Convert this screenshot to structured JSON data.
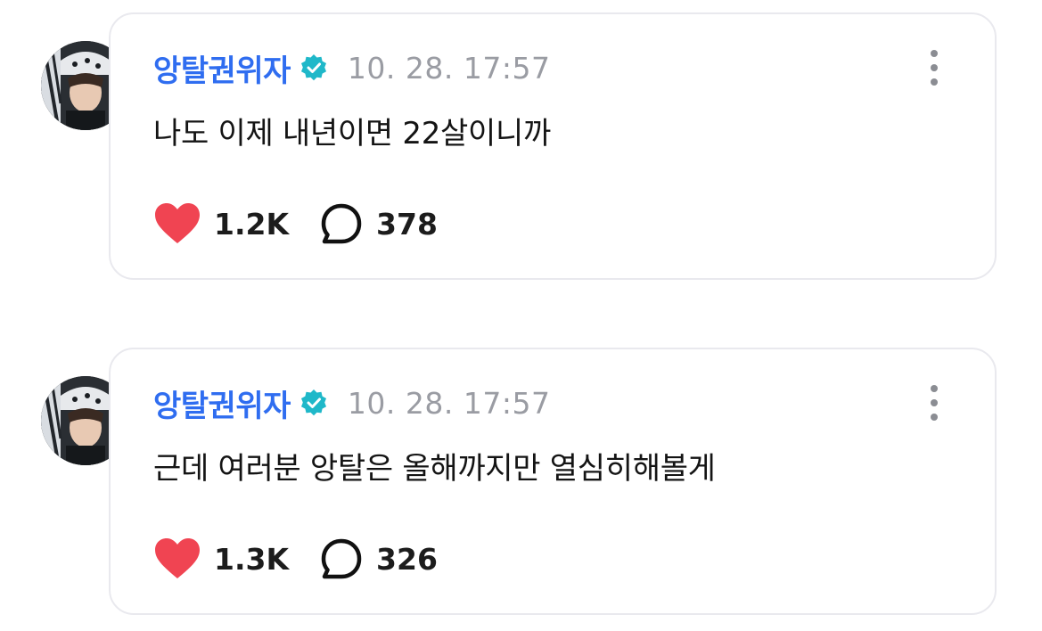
{
  "posts": [
    {
      "author": "앙탈권위자",
      "timestamp": "10. 28. 17:57",
      "text": "나도 이제 내년이면 22살이니까",
      "likes": "1.2K",
      "comments": "378",
      "verified": true
    },
    {
      "author": "앙탈권위자",
      "timestamp": "10. 28. 17:57",
      "text": "근데 여러분 앙탈은 올해까지만 열심히해볼게",
      "likes": "1.3K",
      "comments": "326",
      "verified": true
    }
  ],
  "icons": {
    "verified": "verified-badge-icon",
    "like": "heart-icon",
    "comment": "speech-bubble-icon",
    "more": "more-vertical-icon"
  },
  "colors": {
    "author": "#2f6df0",
    "verified_badge": "#1fb8c9",
    "heart": "#f04452",
    "timestamp": "#9a9ca3",
    "card_border": "#e9e9ee"
  }
}
